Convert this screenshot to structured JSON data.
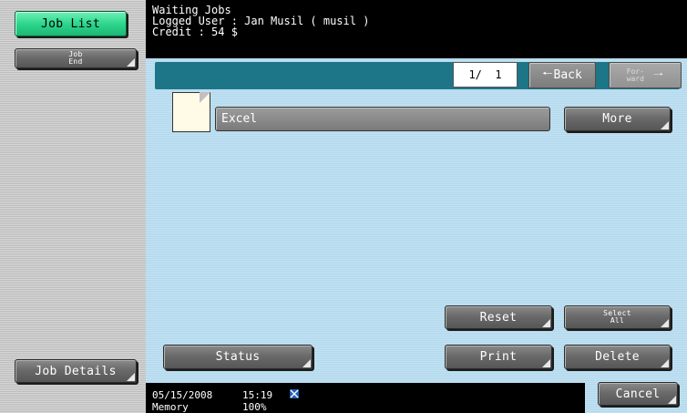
{
  "sidebar": {
    "job_list_label": "Job List",
    "job_end_label": "Job\nEnd",
    "job_details_label": "Job Details"
  },
  "header": {
    "title": "Waiting Jobs",
    "logged_user": "Logged User : Jan Musil ( musil )",
    "credit": "Credit : 54 $"
  },
  "pager": {
    "page": "1/  1",
    "back_label": "Back",
    "forward_label": "For-\nward"
  },
  "jobs": [
    {
      "name": "Excel",
      "more_label": "More"
    }
  ],
  "actions": {
    "reset": "Reset",
    "select_all": "Select\nAll",
    "status": "Status",
    "print": "Print",
    "delete": "Delete"
  },
  "footer": {
    "date": "05/15/2008",
    "time": "15:19",
    "memory_label": "Memory",
    "memory_value": "100%",
    "cancel_label": "Cancel"
  },
  "colors": {
    "accent_green": "#2bd38a",
    "panel_header": "#1c7688",
    "panel_bg": "#b9dcef"
  }
}
